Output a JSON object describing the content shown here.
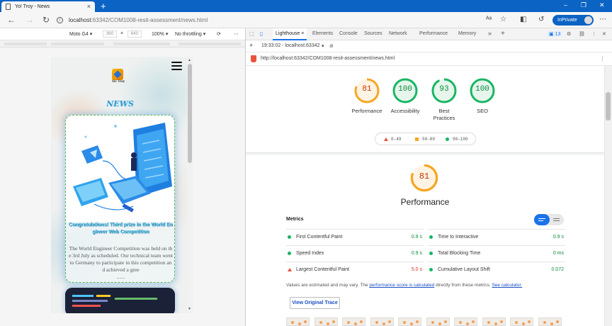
{
  "browser": {
    "tab_title": "Yo! Troy - News",
    "new_tab": "+",
    "url_host": "localhost",
    "url_rest": ":63342/COM1008-resit-assessment/news.html",
    "inprivate_label": "InPrivate"
  },
  "device_toolbar": {
    "device": "Moto G4",
    "width": "360",
    "times": "×",
    "height": "640",
    "zoom": "100%",
    "throttling": "No throttling",
    "more": "⋮"
  },
  "mobile_page": {
    "logo_title": "Yo! Troy",
    "heading": "NEWS",
    "card_title": "Congratulations! Third prize in the World Engineer Web Competition",
    "card_body": "The World Engineer Competition was held on the 3rd July as scheduled. Our technical team went to Germany to participate in this competition and achieved a gree",
    "card_more": "......"
  },
  "devtools": {
    "tabs": [
      "Lighthouse",
      "Elements",
      "Console",
      "Sources",
      "Network",
      "Performance",
      "Memory"
    ],
    "more_tabs": "»",
    "add_tab": "+",
    "issues_count": "13",
    "report_time": "19:33:02 - localhost:63342",
    "report_url": "http://localhost:63342/COM1008-resit-assessment/news.html"
  },
  "lighthouse": {
    "categories": [
      {
        "label": "Performance",
        "score": 81
      },
      {
        "label": "Accessibility",
        "score": 100
      },
      {
        "label": "Best Practices",
        "score": 93
      },
      {
        "label": "SEO",
        "score": 100
      }
    ],
    "legend": {
      "fail": "0–49",
      "average": "50–89",
      "pass": "90–100"
    },
    "perf_score": 81,
    "perf_title": "Performance",
    "metrics_label": "Metrics",
    "metrics": [
      {
        "name": "First Contentful Paint",
        "value": "0.9 s",
        "status": "pass"
      },
      {
        "name": "Time to Interactive",
        "value": "0.9 s",
        "status": "pass"
      },
      {
        "name": "Speed Index",
        "value": "0.9 s",
        "status": "pass"
      },
      {
        "name": "Total Blocking Time",
        "value": "0 ms",
        "status": "pass"
      },
      {
        "name": "Largest Contentful Paint",
        "value": "5.0 s",
        "status": "fail"
      },
      {
        "name": "Cumulative Layout Shift",
        "value": "0.072",
        "status": "pass"
      }
    ],
    "note_prefix": "Values are estimated and may vary. The ",
    "note_link": "performance score is calculated",
    "note_middle": " directly from these metrics. ",
    "note_link2": "See calculator.",
    "view_trace": "View Original Trace",
    "colors": {
      "pass": "#18b663",
      "average": "#f5a623",
      "fail": "#e8533d"
    }
  }
}
